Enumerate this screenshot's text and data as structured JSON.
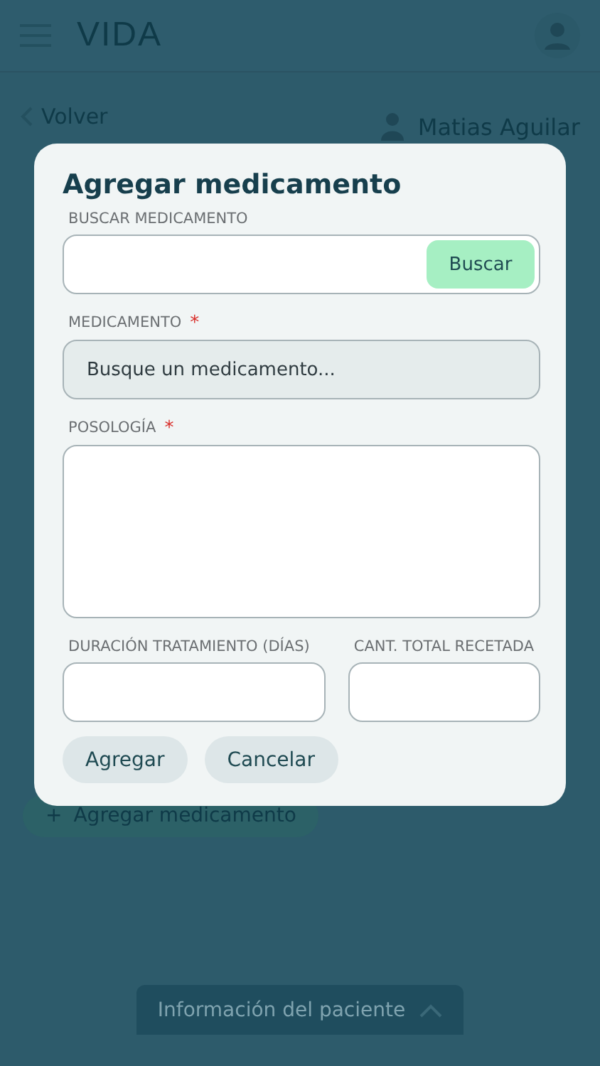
{
  "header": {
    "logo": "VIDA"
  },
  "subheader": {
    "back": "Volver",
    "patient": "Matias Aguilar"
  },
  "add_button": {
    "icon": "+",
    "label": "Agregar medicamento"
  },
  "bottom_tab": {
    "label": "Información del paciente",
    "expanded": false
  },
  "dialog": {
    "title": "Agregar medicamento",
    "search": {
      "label": "BUSCAR MEDICAMENTO",
      "button": "Buscar"
    },
    "medication": {
      "label": "MEDICAMENTO",
      "required_mark": "*",
      "placeholder": "Busque un medicamento..."
    },
    "dosage": {
      "label": "POSOLOGÍA",
      "required_mark": "*"
    },
    "duration": {
      "label": "DURACIÓN TRATAMIENTO (DÍAS)"
    },
    "quantity": {
      "label": "CANT. TOTAL RECETADA"
    },
    "buttons": [
      {
        "label": "Agregar"
      },
      {
        "label": "Cancelar"
      }
    ]
  }
}
